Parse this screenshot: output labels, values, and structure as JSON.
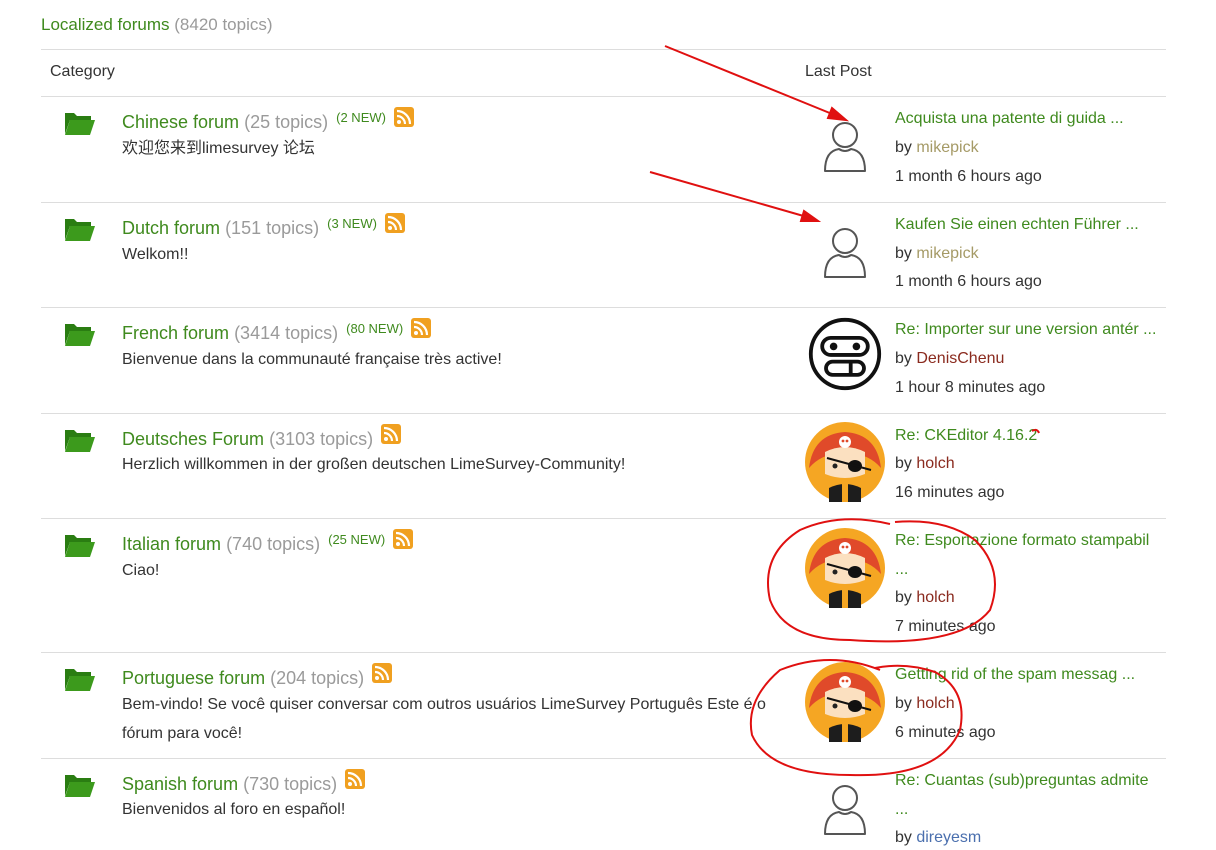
{
  "section": {
    "title": "Localized forums",
    "count": "(8420 topics)"
  },
  "header": {
    "category": "Category",
    "last_post": "Last Post"
  },
  "forums": [
    {
      "name": "Chinese forum",
      "topics": "(25 topics)",
      "new": "(2 NEW)",
      "desc": "欢迎您来到limesurvey 论坛",
      "avatar": "default-user",
      "last_title": "Acquista una patente di guida ...",
      "by": "by ",
      "user": "mikepick",
      "time": "1 month 6 hours ago"
    },
    {
      "name": "Dutch forum",
      "topics": "(151 topics)",
      "new": "(3 NEW)",
      "desc": "Welkom!!",
      "avatar": "default-user",
      "last_title": "Kaufen Sie einen echten Führer ...",
      "by": "by ",
      "user": "mikepick",
      "time": "1 month 6 hours ago"
    },
    {
      "name": "French forum",
      "topics": "(3414 topics)",
      "new": "(80 NEW)",
      "desc": "Bienvenue dans la communauté française très active!",
      "avatar": "face-avatar",
      "last_title": "Re: Importer sur une version antér ...",
      "by": "by ",
      "user": "DenisChenu",
      "time": "1 hour 8 minutes ago"
    },
    {
      "name": "Deutsches Forum",
      "topics": "(3103 topics)",
      "new": "",
      "desc": "Herzlich willkommen in der großen deutschen LimeSurvey-Community!",
      "avatar": "pirate-avatar",
      "last_title": "Re: CKEditor 4.16.2",
      "by": "by ",
      "user": "holch",
      "time": "16 minutes ago"
    },
    {
      "name": "Italian forum",
      "topics": "(740 topics)",
      "new": "(25 NEW)",
      "desc": "Ciao!",
      "avatar": "pirate-avatar",
      "last_title": "Re: Esportazione formato stampabil",
      "last_title2": "...",
      "by": "by ",
      "user": "holch",
      "time": "7 minutes ago"
    },
    {
      "name": "Portuguese forum",
      "topics": "(204 topics)",
      "new": "",
      "desc": "Bem-vindo! Se você quiser conversar com outros usuários LimeSurvey Português Este é o fórum para você!",
      "avatar": "pirate-avatar",
      "last_title": "Getting rid of the spam messag ...",
      "by": "by ",
      "user": "holch",
      "time": "6 minutes ago"
    },
    {
      "name": "Spanish forum",
      "topics": "(730 topics)",
      "new": "",
      "desc": "Bienvenidos al foro en español!",
      "avatar": "default-user",
      "last_title": "Re: Cuantas (sub)preguntas admite",
      "last_title2": "...",
      "by": "by ",
      "user": "direyesm",
      "time": ""
    }
  ],
  "colors": {
    "link": "#3f8a1e",
    "muted": "#9a9a9a",
    "rss": "#f0a020",
    "annotation": "#e01010"
  }
}
